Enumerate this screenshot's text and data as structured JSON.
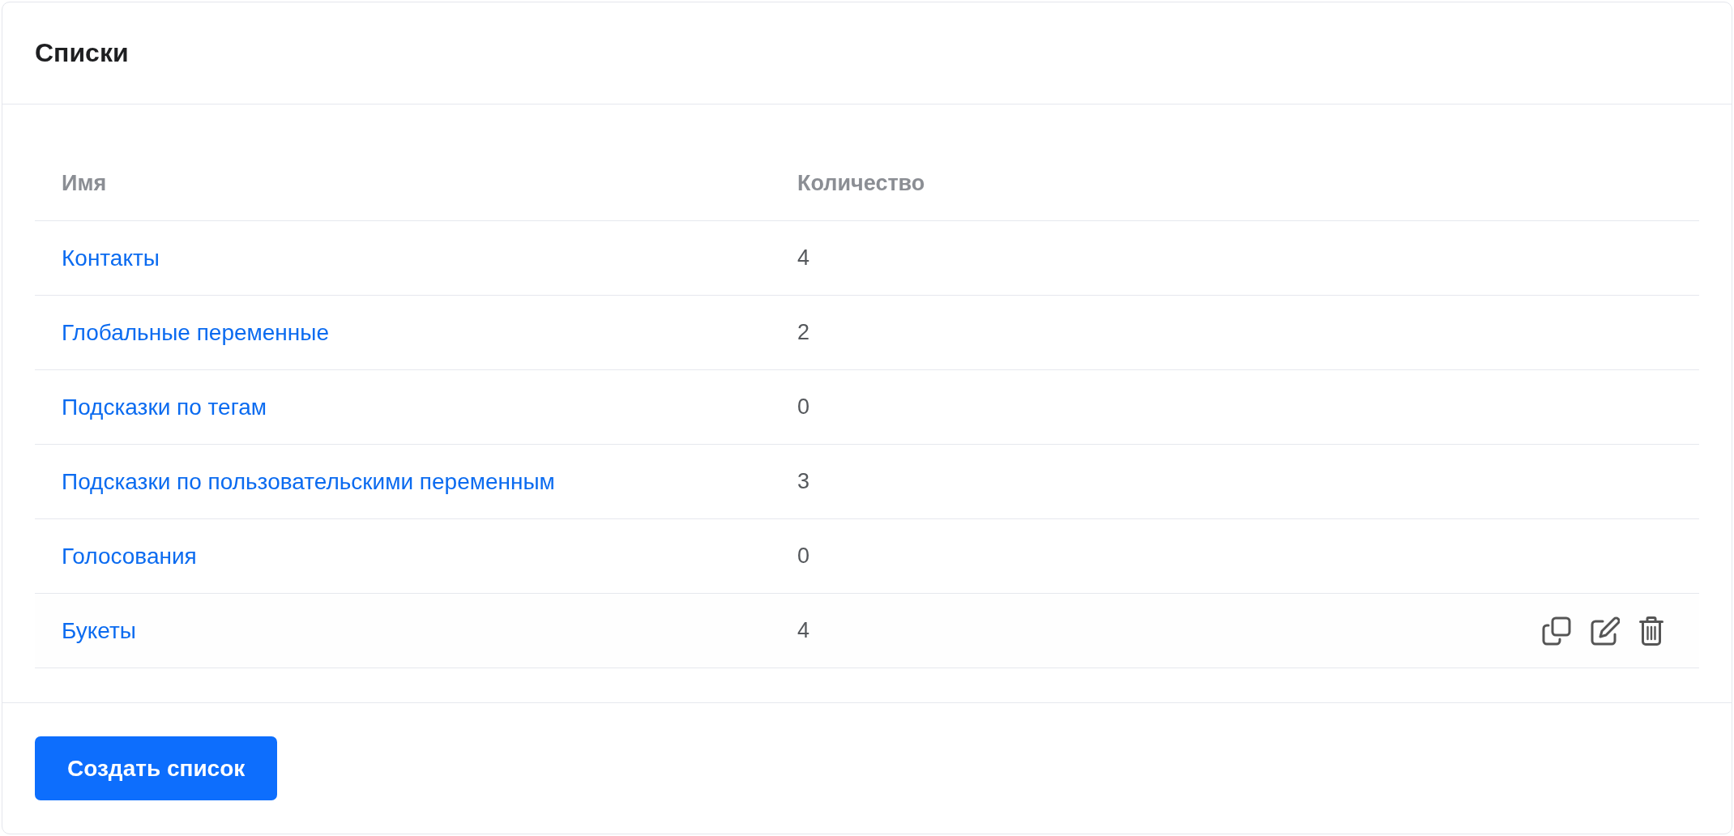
{
  "card": {
    "title": "Списки"
  },
  "table": {
    "columns": [
      "Имя",
      "Количество"
    ],
    "rows": [
      {
        "name": "Контакты",
        "count": "4",
        "actions_visible": false
      },
      {
        "name": "Глобальные переменные",
        "count": "2",
        "actions_visible": false
      },
      {
        "name": "Подсказки по тегам",
        "count": "0",
        "actions_visible": false
      },
      {
        "name": "Подсказки по пользовательскими переменным",
        "count": "3",
        "actions_visible": false
      },
      {
        "name": "Голосования",
        "count": "0",
        "actions_visible": false
      },
      {
        "name": "Букеты",
        "count": "4",
        "actions_visible": true
      }
    ]
  },
  "footer": {
    "button": "Создать список"
  }
}
